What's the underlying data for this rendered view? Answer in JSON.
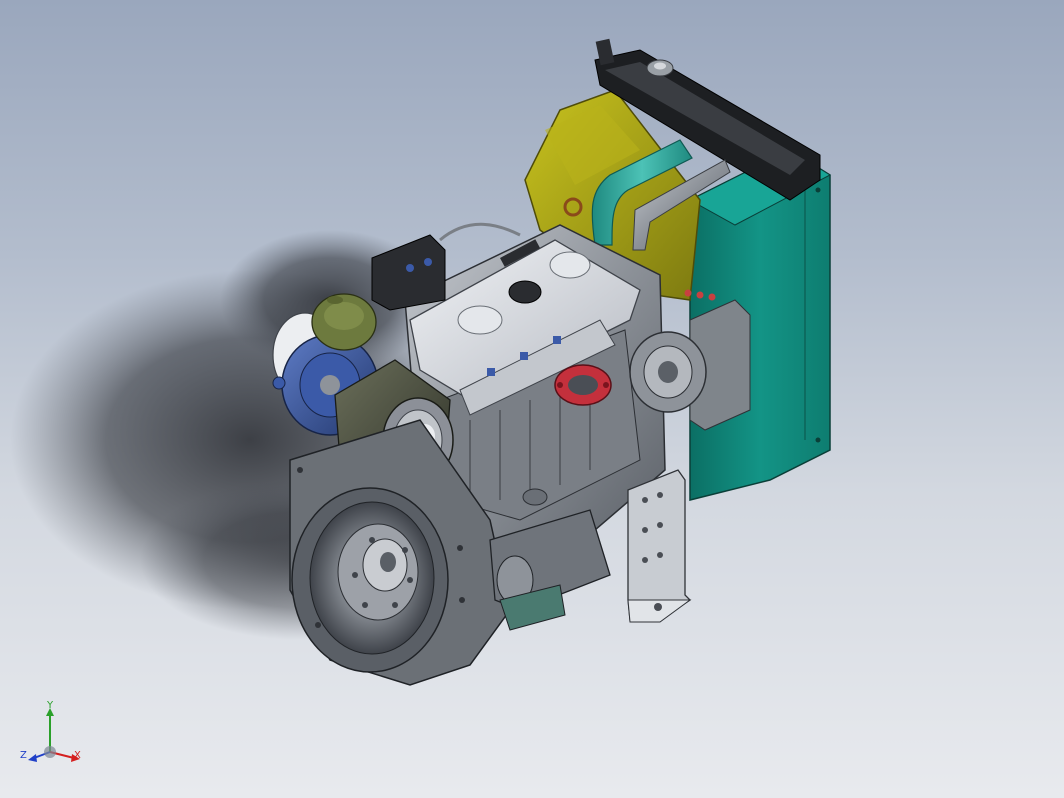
{
  "viewport": {
    "background_top": "#9aa7bd",
    "background_bottom": "#e8eaee"
  },
  "model": {
    "colors": {
      "radiator_housing": "#0f8a7c",
      "fan_shroud": "#a8a316",
      "engine_body": "#8f949a",
      "valve_cover": "#d9dce2",
      "air_filter": "#4c5040",
      "blue_pulley": "#3b5aa8",
      "red_flange": "#c4303c",
      "coolant_hose": "#2fa49a"
    }
  },
  "triad": {
    "x_label": "X",
    "y_label": "Y",
    "z_label": "Z",
    "x_color": "#d42020",
    "y_color": "#2aa02a",
    "z_color": "#2040c8"
  }
}
